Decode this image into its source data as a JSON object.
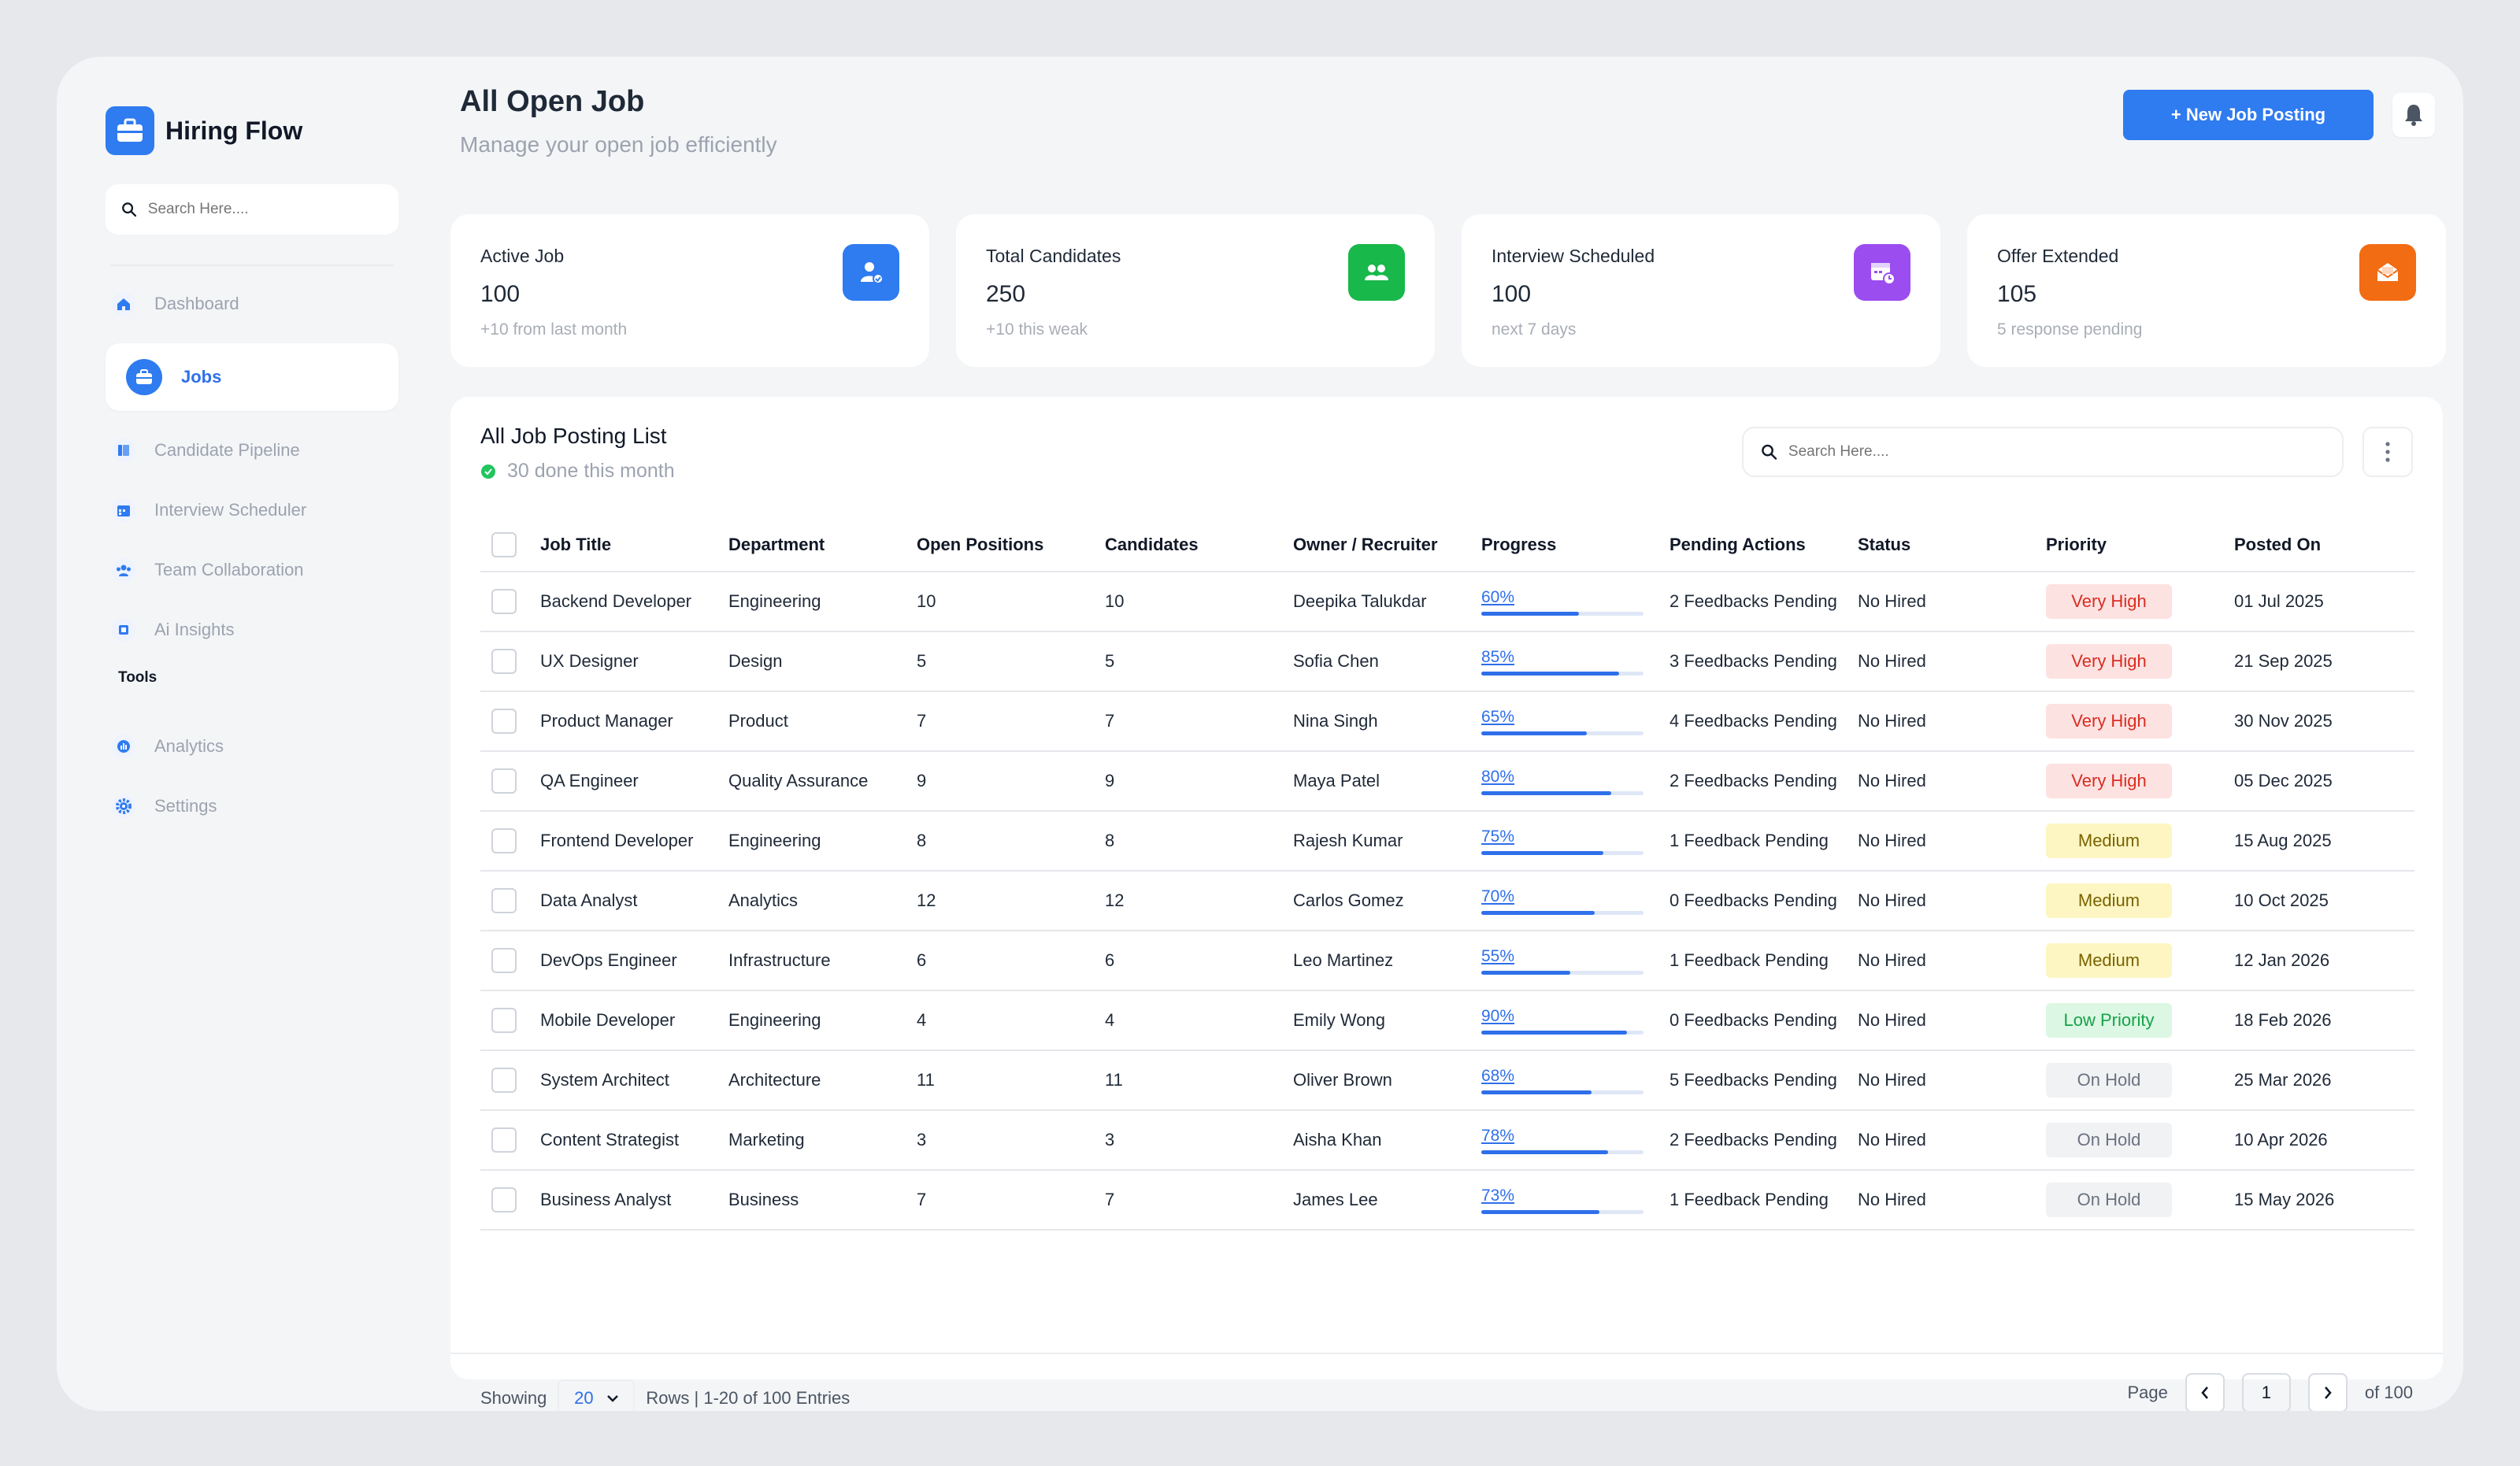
{
  "brand": {
    "name": "Hiring Flow"
  },
  "sidebar": {
    "search_placeholder": "Search Here....",
    "nav": [
      {
        "label": "Dashboard",
        "icon": "home-icon"
      },
      {
        "label": "Jobs",
        "icon": "briefcase-icon",
        "active": true
      },
      {
        "label": "Candidate Pipeline",
        "icon": "pipeline-icon"
      },
      {
        "label": "Interview Scheduler",
        "icon": "calendar-icon"
      },
      {
        "label": "Team Collaboration",
        "icon": "team-icon"
      },
      {
        "label": "Ai Insights",
        "icon": "ai-chip-icon"
      }
    ],
    "tools_title": "Tools",
    "tools": [
      {
        "label": "Analytics",
        "icon": "analytics-icon"
      },
      {
        "label": "Settings",
        "icon": "settings-icon"
      }
    ]
  },
  "header": {
    "title": "All Open Job",
    "subtitle": "Manage your open job efficiently",
    "new_button": "+ New Job Posting"
  },
  "stats": [
    {
      "label": "Active Job",
      "value": "100",
      "note": "+10 from last month",
      "color": "#2f7bf0",
      "icon": "user-check-icon"
    },
    {
      "label": "Total Candidates",
      "value": "250",
      "note": "+10 this weak",
      "color": "#18b84a",
      "icon": "users-icon"
    },
    {
      "label": "Interview Scheduled",
      "value": "100",
      "note": "next 7 days",
      "color": "#9b4df0",
      "icon": "calendar-clock-icon"
    },
    {
      "label": "Offer Extended",
      "value": "105",
      "note": "5 response pending",
      "color": "#f26c13",
      "icon": "envelope-open-icon"
    }
  ],
  "table": {
    "title": "All Job Posting List",
    "subtitle": "30 done this month",
    "search_placeholder": "Search Here....",
    "columns": [
      "Job Title",
      "Department",
      "Open Positions",
      "Candidates",
      "Owner / Recruiter",
      "Progress",
      "Pending Actions",
      "Status",
      "Priority",
      "Posted On"
    ],
    "rows": [
      {
        "title": "Backend Developer",
        "department": "Engineering",
        "open": "10",
        "candidates": "10",
        "owner": "Deepika Talukdar",
        "progress": "60%",
        "pending": "2 Feedbacks Pending",
        "status": "No Hired",
        "priority": "Very High",
        "posted": "01 Jul 2025"
      },
      {
        "title": "UX Designer",
        "department": "Design",
        "open": "5",
        "candidates": "5",
        "owner": "Sofia Chen",
        "progress": "85%",
        "pending": "3 Feedbacks Pending",
        "status": "No Hired",
        "priority": "Very High",
        "posted": "21 Sep 2025"
      },
      {
        "title": "Product Manager",
        "department": "Product",
        "open": "7",
        "candidates": "7",
        "owner": "Nina Singh",
        "progress": "65%",
        "pending": "4 Feedbacks Pending",
        "status": "No Hired",
        "priority": "Very High",
        "posted": "30 Nov 2025"
      },
      {
        "title": "QA Engineer",
        "department": "Quality Assurance",
        "open": "9",
        "candidates": "9",
        "owner": "Maya Patel",
        "progress": "80%",
        "pending": "2 Feedbacks Pending",
        "status": "No Hired",
        "priority": "Very High",
        "posted": "05 Dec 2025"
      },
      {
        "title": "Frontend Developer",
        "department": "Engineering",
        "open": "8",
        "candidates": "8",
        "owner": "Rajesh Kumar",
        "progress": "75%",
        "pending": "1 Feedback Pending",
        "status": "No Hired",
        "priority": "Medium",
        "posted": "15 Aug 2025"
      },
      {
        "title": "Data Analyst",
        "department": "Analytics",
        "open": "12",
        "candidates": "12",
        "owner": "Carlos Gomez",
        "progress": "70%",
        "pending": "0 Feedbacks Pending",
        "status": "No Hired",
        "priority": "Medium",
        "posted": "10 Oct 2025"
      },
      {
        "title": "DevOps Engineer",
        "department": "Infrastructure",
        "open": "6",
        "candidates": "6",
        "owner": "Leo Martinez",
        "progress": "55%",
        "pending": "1 Feedback Pending",
        "status": "No Hired",
        "priority": "Medium",
        "posted": "12 Jan 2026"
      },
      {
        "title": "Mobile Developer",
        "department": "Engineering",
        "open": "4",
        "candidates": "4",
        "owner": "Emily Wong",
        "progress": "90%",
        "pending": "0 Feedbacks Pending",
        "status": "No Hired",
        "priority": "Low Priority",
        "posted": "18 Feb 2026"
      },
      {
        "title": "System Architect",
        "department": "Architecture",
        "open": "11",
        "candidates": "11",
        "owner": "Oliver Brown",
        "progress": "68%",
        "pending": "5 Feedbacks Pending",
        "status": "No Hired",
        "priority": "On Hold",
        "posted": "25 Mar 2026"
      },
      {
        "title": "Content Strategist",
        "department": "Marketing",
        "open": "3",
        "candidates": "3",
        "owner": "Aisha Khan",
        "progress": "78%",
        "pending": "2 Feedbacks Pending",
        "status": "No Hired",
        "priority": "On Hold",
        "posted": "10 Apr 2026"
      },
      {
        "title": "Business Analyst",
        "department": "Business",
        "open": "7",
        "candidates": "7",
        "owner": "James Lee",
        "progress": "73%",
        "pending": "1 Feedback Pending",
        "status": "No Hired",
        "priority": "On Hold",
        "posted": "15 May 2026"
      }
    ],
    "priority_styles": {
      "Very High": {
        "bg": "#fde2e2",
        "fg": "#d92d20"
      },
      "Medium": {
        "bg": "#fdf6c3",
        "fg": "#7a6300"
      },
      "Low Priority": {
        "bg": "#dcf7e3",
        "fg": "#16a34a"
      },
      "On Hold": {
        "bg": "#f1f2f4",
        "fg": "#6b7280"
      }
    }
  },
  "footer": {
    "showing": "Showing",
    "rows_value": "20",
    "rows_text": "Rows | 1-20 of 100 Entries",
    "page_label": "Page",
    "page_value": "1",
    "of_text": "of 100"
  }
}
